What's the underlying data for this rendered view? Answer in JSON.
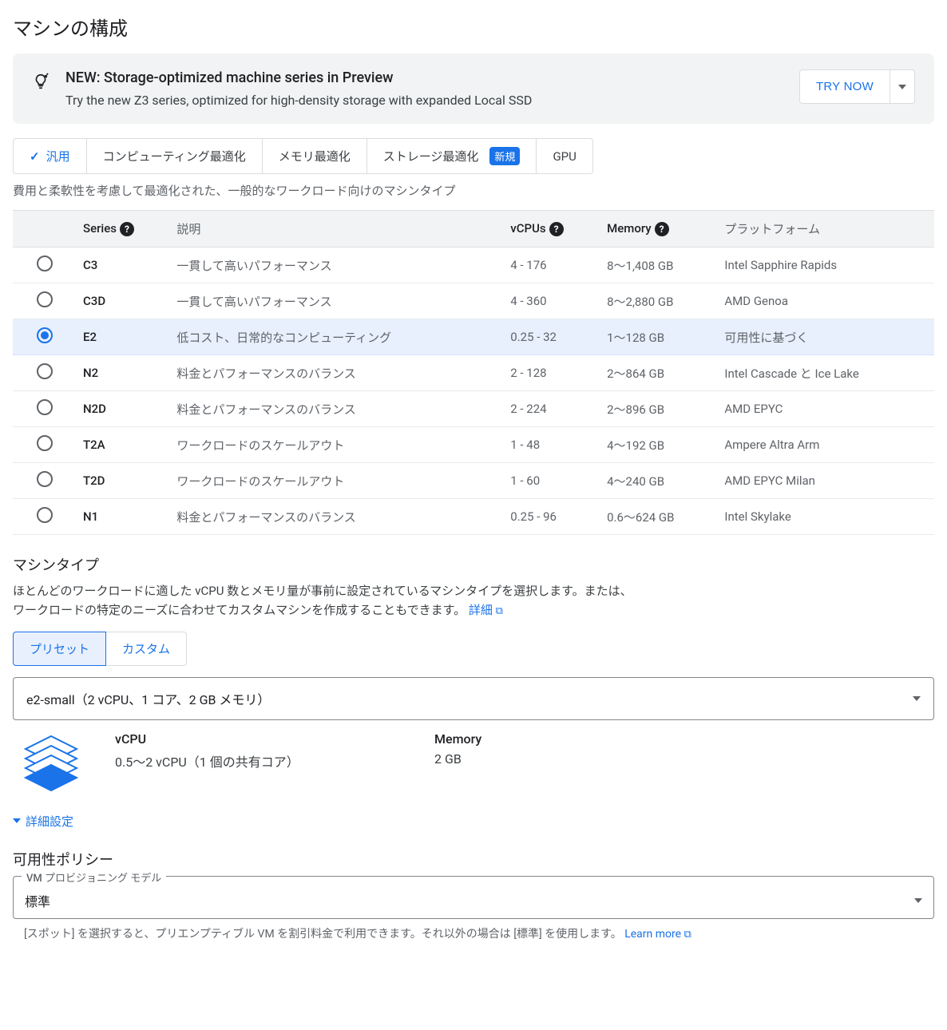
{
  "header": {
    "title": "マシンの構成"
  },
  "banner": {
    "title": "NEW: Storage-optimized machine series in Preview",
    "desc": "Try the new Z3 series, optimized for high-density storage with expanded Local SSD",
    "try_label": "TRY NOW"
  },
  "tabs": {
    "general": "汎用",
    "compute": "コンピューティング最適化",
    "memory": "メモリ最適化",
    "storage": "ストレージ最適化",
    "storage_badge": "新規",
    "gpu": "GPU",
    "desc": "費用と柔軟性を考慮して最適化された、一般的なワークロード向けのマシンタイプ"
  },
  "table": {
    "headers": {
      "series": "Series",
      "desc": "説明",
      "vcpus": "vCPUs",
      "memory": "Memory",
      "platform": "プラットフォーム"
    },
    "rows": [
      {
        "series": "C3",
        "desc": "一貫して高いパフォーマンス",
        "vcpus": "4 - 176",
        "memory": "8〜1,408 GB",
        "platform": "Intel Sapphire Rapids",
        "selected": false
      },
      {
        "series": "C3D",
        "desc": "一貫して高いパフォーマンス",
        "vcpus": "4 - 360",
        "memory": "8〜2,880 GB",
        "platform": "AMD Genoa",
        "selected": false
      },
      {
        "series": "E2",
        "desc": "低コスト、日常的なコンピューティング",
        "vcpus": "0.25 - 32",
        "memory": "1〜128 GB",
        "platform": "可用性に基づく",
        "selected": true
      },
      {
        "series": "N2",
        "desc": "料金とパフォーマンスのバランス",
        "vcpus": "2 - 128",
        "memory": "2〜864 GB",
        "platform": "Intel Cascade と Ice Lake",
        "selected": false
      },
      {
        "series": "N2D",
        "desc": "料金とパフォーマンスのバランス",
        "vcpus": "2 - 224",
        "memory": "2〜896 GB",
        "platform": "AMD EPYC",
        "selected": false
      },
      {
        "series": "T2A",
        "desc": "ワークロードのスケールアウト",
        "vcpus": "1 - 48",
        "memory": "4〜192 GB",
        "platform": "Ampere Altra Arm",
        "selected": false
      },
      {
        "series": "T2D",
        "desc": "ワークロードのスケールアウト",
        "vcpus": "1 - 60",
        "memory": "4〜240 GB",
        "platform": "AMD EPYC Milan",
        "selected": false
      },
      {
        "series": "N1",
        "desc": "料金とパフォーマンスのバランス",
        "vcpus": "0.25 - 96",
        "memory": "0.6〜624 GB",
        "platform": "Intel Skylake",
        "selected": false
      }
    ]
  },
  "machine_type": {
    "title": "マシンタイプ",
    "desc": "ほとんどのワークロードに適した vCPU 数とメモリ量が事前に設定されているマシンタイプを選択します。または、ワークロードの特定のニーズに合わせてカスタムマシンを作成することもできます。",
    "details_link": "詳細",
    "preset": "プリセット",
    "custom": "カスタム",
    "dropdown_value": "e2-small（2 vCPU、1 コア、2 GB メモリ）",
    "vcpu_label": "vCPU",
    "vcpu_value": "0.5〜2 vCPU（1 個の共有コア）",
    "memory_label": "Memory",
    "memory_value": "2 GB",
    "advanced": "詳細設定"
  },
  "availability": {
    "title": "可用性ポリシー",
    "field_label": "VM プロビジョニング モデル",
    "field_value": "標準",
    "helper_pre": "[スポット] を選択すると、プリエンプティブル VM を割引料金で利用できます。それ以外の場合は [標準] を使用します。",
    "learn_more": "Learn more"
  }
}
